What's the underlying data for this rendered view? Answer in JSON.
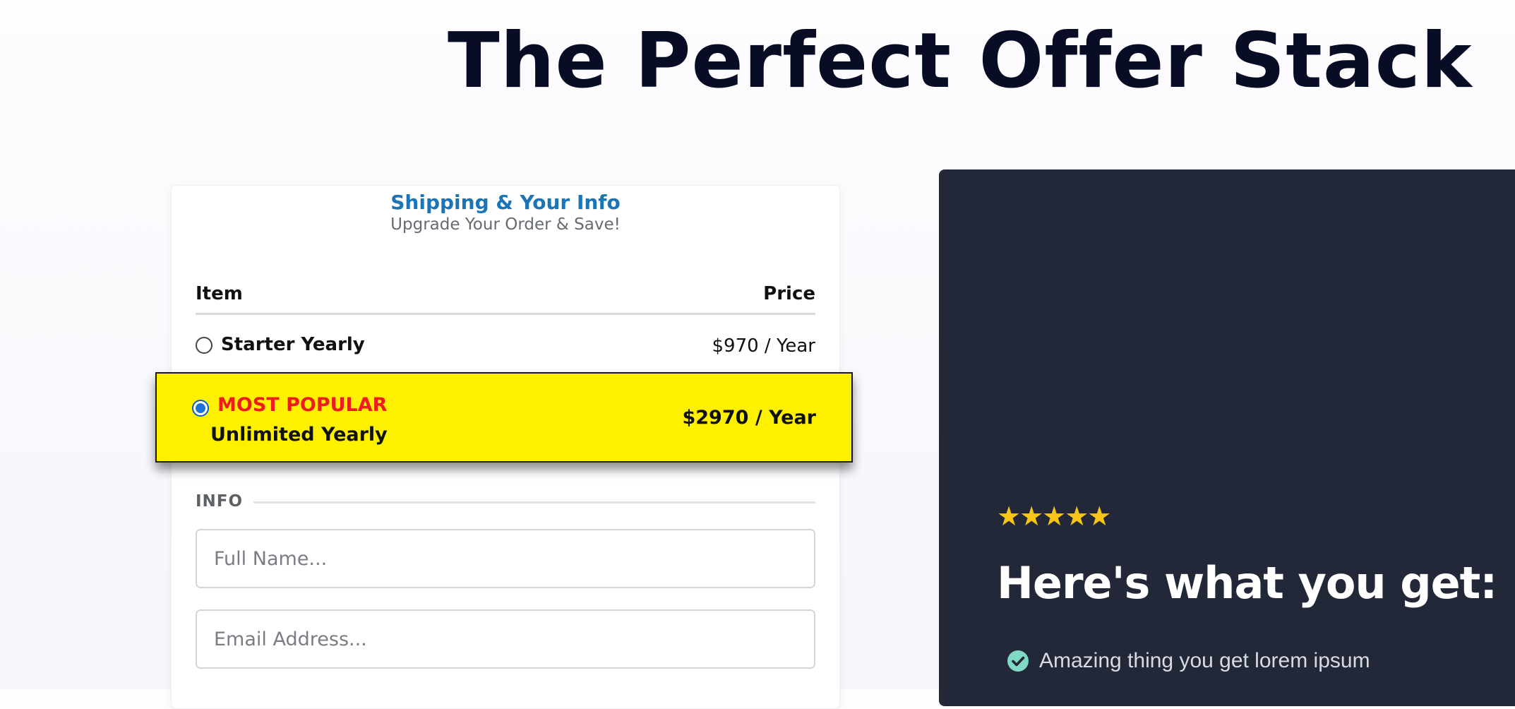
{
  "page": {
    "title": "The Perfect Offer Stack"
  },
  "order_form": {
    "heading": "Shipping & Your Info",
    "subheading": "Upgrade Your Order & Save!",
    "columns": {
      "item": "Item",
      "price": "Price"
    },
    "products": [
      {
        "name": "Starter Yearly",
        "price": "$970 / Year",
        "selected": false
      }
    ],
    "featured": {
      "badge": "MOST POPULAR",
      "name": "Unlimited Yearly",
      "price": "$2970 / Year",
      "selected": true
    },
    "info_section": {
      "label": "INFO",
      "full_name_placeholder": "Full Name...",
      "full_name_value": "",
      "email_placeholder": "Email Address...",
      "email_value": ""
    }
  },
  "benefits": {
    "stars": "★★★★★",
    "rating": 5,
    "heading": "Here's what you get:",
    "items": [
      {
        "icon": "check-circle-icon",
        "text": "Amazing thing you get lorem ipsum"
      }
    ]
  },
  "colors": {
    "title": "#080c24",
    "heading_blue": "#1a74b6",
    "featured_bg": "#fdf100",
    "badge_red": "#ee1c1c",
    "panel_bg": "#232838",
    "star": "#f5c518",
    "check": "#7fd9c4"
  }
}
